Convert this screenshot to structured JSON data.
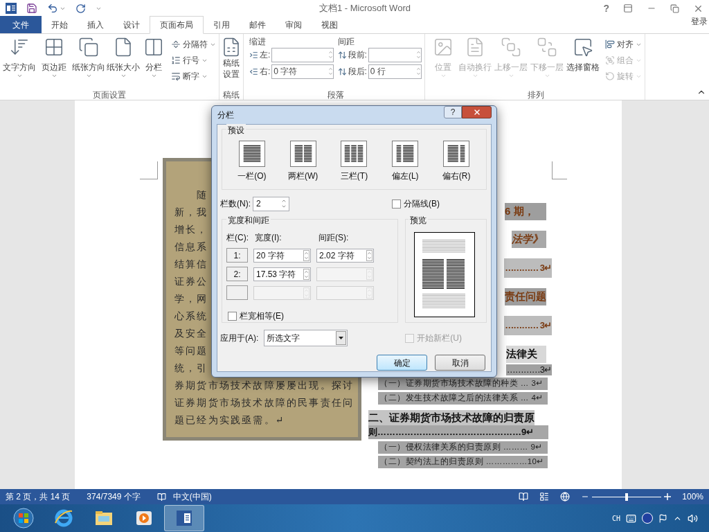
{
  "title_bar": {
    "title": "文档1 - Microsoft Word",
    "help": "?"
  },
  "tabs": [
    {
      "label": "文件",
      "kind": "file",
      "selected": false
    },
    {
      "label": "开始",
      "kind": "tab",
      "selected": false
    },
    {
      "label": "插入",
      "kind": "tab",
      "selected": false
    },
    {
      "label": "设计",
      "kind": "tab",
      "selected": false
    },
    {
      "label": "页面布局",
      "kind": "tab",
      "selected": true
    },
    {
      "label": "引用",
      "kind": "tab",
      "selected": false
    },
    {
      "label": "邮件",
      "kind": "tab",
      "selected": false
    },
    {
      "label": "审阅",
      "kind": "tab",
      "selected": false
    },
    {
      "label": "视图",
      "kind": "tab",
      "selected": false
    }
  ],
  "sign_in": "登录",
  "ribbon": {
    "page_setup": {
      "label": "页面设置",
      "large": [
        "文字方向",
        "页边距",
        "纸张方向",
        "纸张大小",
        "分栏"
      ],
      "small": [
        "分隔符",
        "行号",
        "断字"
      ]
    },
    "draft": {
      "label": "稿纸",
      "button": "稿纸设置"
    },
    "paragraph": {
      "label": "段落",
      "indent_label": "缩进",
      "spacing_label": "间距",
      "fields": [
        {
          "label": "左:"
        },
        {
          "label": "右:",
          "value": "0 字符"
        },
        {
          "label": "段前:"
        },
        {
          "label": "段后:",
          "value": "0 行"
        }
      ]
    },
    "arrange": {
      "label": "排列",
      "large": [
        {
          "label": "位置",
          "disabled": true
        },
        {
          "label": "自动换行",
          "disabled": true
        },
        {
          "label": "上移一层",
          "disabled": true
        },
        {
          "label": "下移一层",
          "disabled": true
        },
        {
          "label": "选择窗格",
          "disabled": false
        }
      ],
      "small": [
        {
          "label": "对齐",
          "disabled": false
        },
        {
          "label": "组合",
          "disabled": true
        },
        {
          "label": "旋转",
          "disabled": true
        }
      ]
    }
  },
  "document": {
    "left_lines": [
      {
        "text": "随",
        "kind": "indent"
      },
      {
        "text": "新，我",
        "kind": "cut"
      },
      {
        "text": "增长，",
        "kind": "cut"
      },
      {
        "text": "信息系",
        "kind": "cut"
      },
      {
        "text": "结算信",
        "kind": "cut"
      },
      {
        "text": "证券公",
        "kind": "cut"
      },
      {
        "text": "学，网",
        "kind": "cut"
      },
      {
        "text": "心系统",
        "kind": "cut"
      },
      {
        "text": "及安全",
        "kind": "cut"
      },
      {
        "text": "等问题",
        "kind": "cut"
      },
      {
        "text": "统，引",
        "kind": "cut"
      },
      {
        "text": "券期货市场技术故障屡屡出现。探讨",
        "kind": "full"
      },
      {
        "text": "证券期货市场技术故障的民事责任问",
        "kind": "full"
      },
      {
        "text": "题已经为实践亟需。↵",
        "kind": "full"
      }
    ],
    "right_lines": [
      {
        "text": "6 期，",
        "kind": "cut_bold"
      },
      {
        "text": "法学》",
        "kind": "cut_italic"
      },
      {
        "text": "………… 3↵",
        "kind": "cut_dots"
      },
      {
        "text": "责任问题",
        "kind": "cut_bold"
      },
      {
        "text": "………… 3↵",
        "kind": "cut_dots"
      },
      {
        "text": "法律关",
        "kind": "cut_black"
      },
      {
        "text": "…………3↵",
        "kind": "cut_small_dots"
      },
      {
        "text": "（一）证券期货市场技术故障的种类 … 3↵",
        "kind": "sub"
      },
      {
        "text": "（二）发生技术故障之后的法律关系 … 4↵",
        "kind": "sub"
      },
      {
        "text": "二、证券期货市场技术故障的归责原",
        "kind": "heading"
      },
      {
        "text": "则…………………………………………9↵",
        "kind": "heading_dots"
      },
      {
        "text": "（一）侵权法律关系的归责原则 ……… 9↵",
        "kind": "sub"
      },
      {
        "text": "（二）契约法上的归责原则 ……………10↵",
        "kind": "sub"
      }
    ]
  },
  "dialog": {
    "title": "分栏",
    "presets_label": "预设",
    "presets": [
      {
        "label": "一栏(O)",
        "kind": "one",
        "selected": false
      },
      {
        "label": "两栏(W)",
        "kind": "two",
        "selected": false
      },
      {
        "label": "三栏(T)",
        "kind": "three",
        "selected": false
      },
      {
        "label": "偏左(L)",
        "kind": "left",
        "selected": false
      },
      {
        "label": "偏右(R)",
        "kind": "right",
        "selected": false
      }
    ],
    "count_label": "栏数(N):",
    "count": "2",
    "separator": {
      "label": "分隔线(B)",
      "checked": false
    },
    "width_group": "宽度和间距",
    "col_header": "栏(C):",
    "width_header": "宽度(I):",
    "spacing_header": "间距(S):",
    "rows": [
      {
        "number": "1:",
        "width": "20 字符",
        "width_disabled": false,
        "spacing": "2.02 字符",
        "spacing_disabled": false
      },
      {
        "number": "2:",
        "width": "17.53 字符",
        "width_disabled": false,
        "spacing_disabled": true
      },
      {
        "width_disabled": true,
        "spacing_disabled": true
      }
    ],
    "equal": {
      "label": "栏宽相等(E)",
      "checked": false
    },
    "preview_label": "预览",
    "apply_label": "应用于(A):",
    "apply_value": "所选文字",
    "new_column": {
      "label": "开始新栏(U)",
      "checked": false,
      "disabled": true
    },
    "ok": "确定",
    "cancel": "取消"
  },
  "status_bar": {
    "page": "第 2 页，共 14 页",
    "words": "374/7349 个字",
    "language": "中文(中国)",
    "zoom": {
      "level": 0.5
    },
    "zoom_text": "100%"
  },
  "taskbar": {
    "apps": [
      {
        "selected": false
      },
      {
        "selected": false
      },
      {
        "selected": false
      },
      {
        "selected": false
      },
      {
        "selected": true
      }
    ],
    "ime": "CH"
  }
}
